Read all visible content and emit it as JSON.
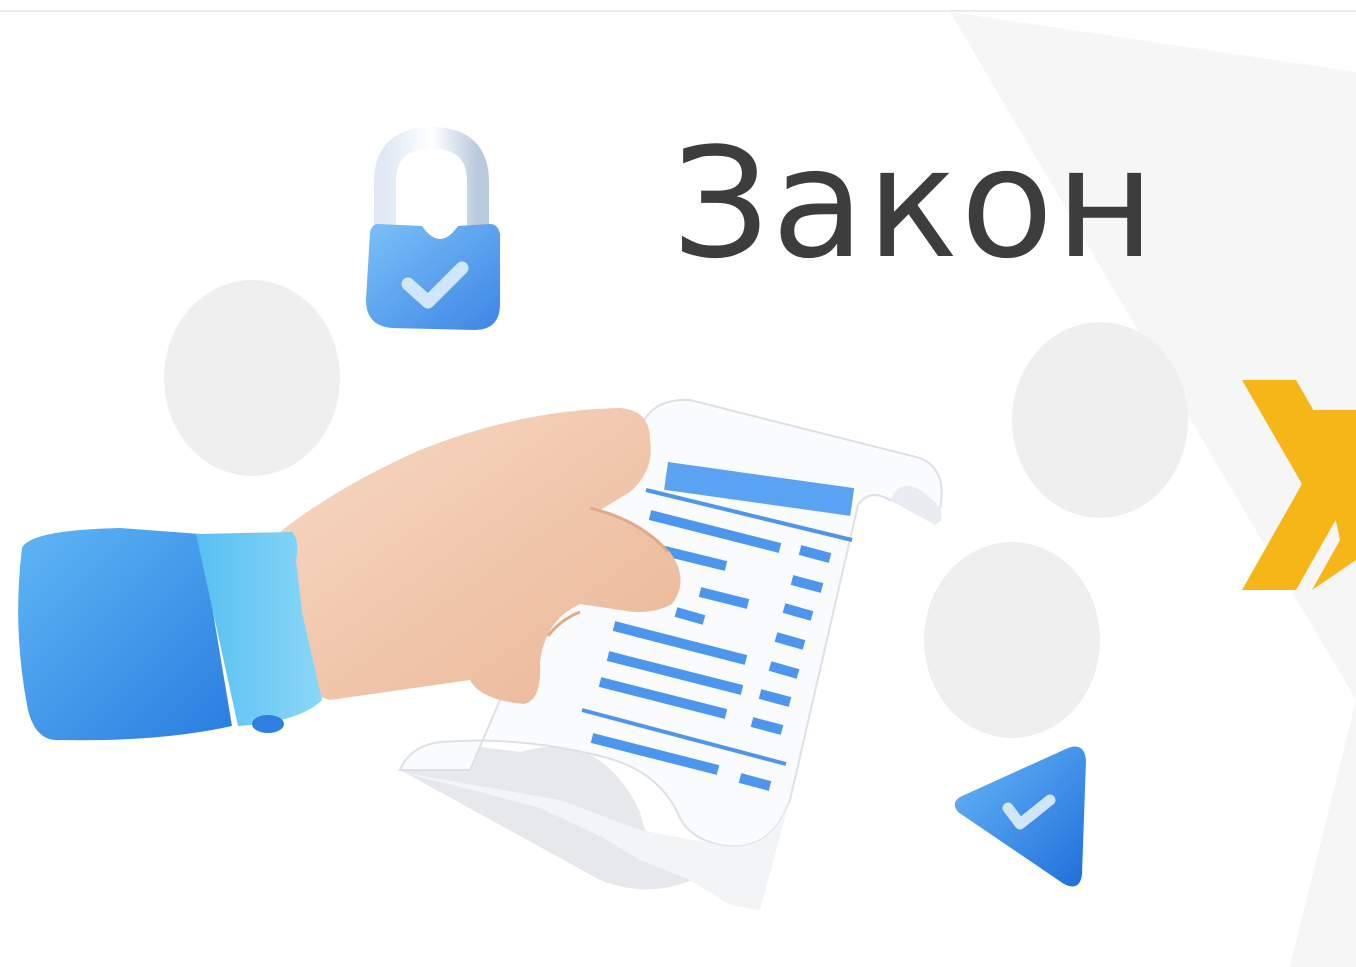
{
  "slide": {
    "title": "Закон"
  },
  "colors": {
    "title_text": "#3d3d3d",
    "accent_yellow": "#f6b618",
    "accent_blue": "#3f8ff0",
    "paper": "#f7f8fa",
    "hand": "#f5cdb3"
  },
  "icons": {
    "padlock": "padlock-check-icon",
    "triangle": "triangle-check-icon",
    "chevron": "double-chevron-right-icon"
  }
}
